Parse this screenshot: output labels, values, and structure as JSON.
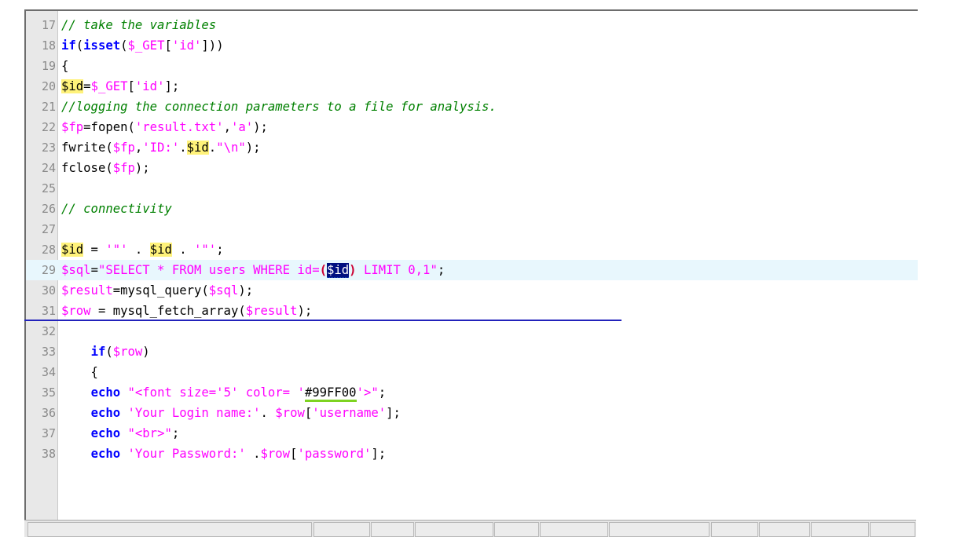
{
  "lines": [
    {
      "num": "17",
      "code": "<span class=\"cm\">// take the variables</span>"
    },
    {
      "num": "18",
      "code": "<span class=\"kw\">if</span>(<span class=\"kw\">isset</span>(<span class=\"var\">$_GET</span>[<span class=\"str\">'id'</span>]))"
    },
    {
      "num": "19",
      "code": "{"
    },
    {
      "num": "20",
      "code": "<span class=\"hl var\">$id</span>=<span class=\"var\">$_GET</span>[<span class=\"str\">'id'</span>];"
    },
    {
      "num": "21",
      "code": "<span class=\"cm\">//logging the connection parameters to a file for analysis.</span>"
    },
    {
      "num": "22",
      "code": "<span class=\"var\">$fp</span>=fopen(<span class=\"str\">'result.txt'</span>,<span class=\"str\">'a'</span>);"
    },
    {
      "num": "23",
      "code": "fwrite(<span class=\"var\">$fp</span>,<span class=\"str\">'ID:'</span>.<span class=\"hl var\">$id</span>.<span class=\"str\">\"<span class=\"esc\">\\n</span>\"</span>);"
    },
    {
      "num": "24",
      "code": "fclose(<span class=\"var\">$fp</span>);"
    },
    {
      "num": "25",
      "code": ""
    },
    {
      "num": "26",
      "code": "<span class=\"cm\">// connectivity</span>"
    },
    {
      "num": "27",
      "code": ""
    },
    {
      "num": "28",
      "code": "<span class=\"hl var\">$id</span> = <span class=\"str\">'\"'</span> . <span class=\"hl var\">$id</span> . <span class=\"str\">'\"'</span>;"
    },
    {
      "num": "29",
      "code": "<span class=\"var\">$sql</span>=<span class=\"str\">\"SELECT * FROM users WHERE id=<span class=\"paren\">(</span><span class=\"sel dotted\">$id</span><span class=\"paren\">)</span> LIMIT 0,1\"</span>;",
      "current": true
    },
    {
      "num": "30",
      "code": "<span class=\"var\">$result</span>=mysql_query(<span class=\"var\">$sql</span>);"
    },
    {
      "num": "31",
      "code": "<span class=\"var\">$row</span> = mysql_fetch_array(<span class=\"var\">$result</span>);"
    },
    {
      "num": "32",
      "code": ""
    },
    {
      "num": "33",
      "code": "    <span class=\"kw\">if</span>(<span class=\"var\">$row</span>)"
    },
    {
      "num": "34",
      "code": "    {"
    },
    {
      "num": "35",
      "code": "    <span class=\"kw\">echo</span> <span class=\"str\">\"&lt;font size='5' color= '<span class=\"wavy\" style=\"color:#000\">#99FF00</span>'&gt;\"</span>;"
    },
    {
      "num": "36",
      "code": "    <span class=\"kw\">echo</span> <span class=\"str\">'Your Login name:'</span>. <span class=\"var\">$row</span>[<span class=\"str\">'username'</span>];"
    },
    {
      "num": "37",
      "code": "    <span class=\"kw\">echo</span> <span class=\"str\">\"&lt;br&gt;\"</span>;"
    },
    {
      "num": "38",
      "code": "    <span class=\"kw\">echo</span> <span class=\"str\">'Your Password:'</span> .<span class=\"var\">$row</span>[<span class=\"str\">'password'</span>];"
    }
  ],
  "status_bar": {
    "cells": [
      "",
      "",
      "",
      "",
      "",
      "",
      "",
      "",
      "",
      "",
      ""
    ]
  }
}
